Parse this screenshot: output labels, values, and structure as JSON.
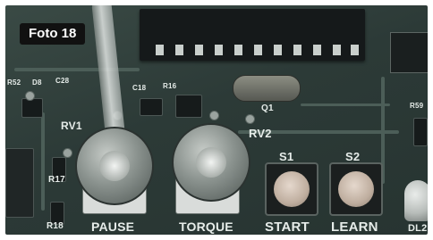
{
  "photo": {
    "tag": "Foto 18",
    "silkscreen": {
      "rv1": "RV1",
      "rv2": "RV2",
      "s1": "S1",
      "s2": "S2",
      "pause": "PAUSE",
      "torque": "TORQUE",
      "start": "START",
      "learn": "LEARN",
      "dl2": "DL2",
      "r17": "R17",
      "r18": "R18",
      "q1": "Q1",
      "d8": "D8",
      "c18": "C18",
      "r16": "R16",
      "c28": "C28",
      "r52": "R52",
      "r59": "R59"
    }
  }
}
